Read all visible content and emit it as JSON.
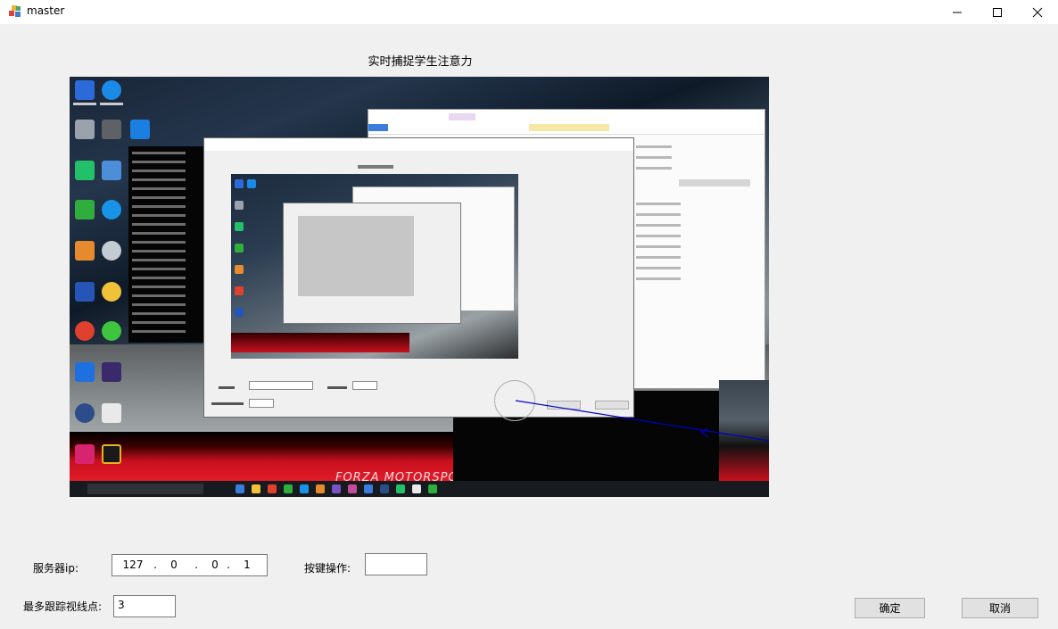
{
  "window": {
    "title": "master",
    "icon": "app-cubes-icon",
    "controls": [
      "minimize-icon",
      "maximize-icon",
      "close-icon"
    ]
  },
  "heading": "实时捕捉学生注意力",
  "screen_capture": {
    "brand_text": "FORZA MOTORSPORT"
  },
  "form": {
    "server_ip_label": "服务器ip:",
    "server_ip": [
      "127",
      "0",
      "0",
      "1"
    ],
    "key_op_label": "按键操作:",
    "key_op_value": "",
    "max_points_label": "最多跟踪视线点:",
    "max_points_value": "3"
  },
  "buttons": {
    "ok": "确定",
    "cancel": "取消"
  },
  "colors": {
    "window_bg": "#f0f0f0",
    "titlebar_bg": "#ffffff",
    "gaze_line": "#0000cc"
  }
}
